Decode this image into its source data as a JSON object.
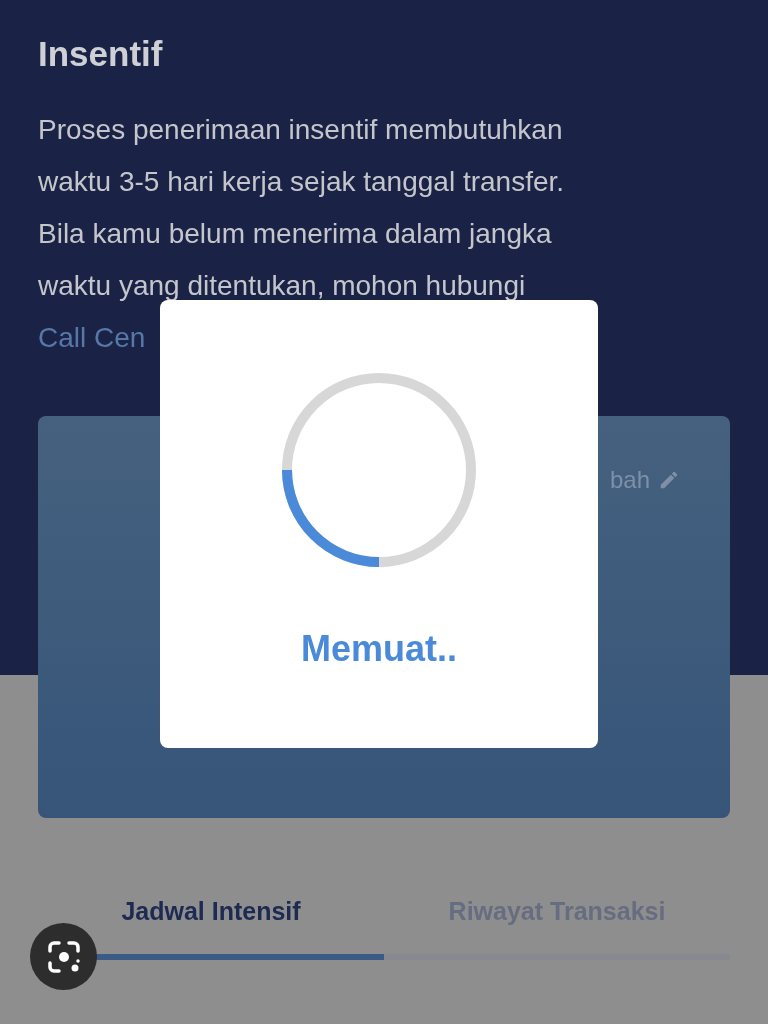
{
  "title": "Insentif",
  "info": {
    "lines": [
      "Proses penerimaan insentif membutuhkan",
      "waktu 3-5 hari kerja sejak tanggal transfer.",
      "Bila kamu belum menerima dalam jangka",
      "waktu yang ditentukan, mohon hubungi"
    ],
    "link": "Call Cen"
  },
  "card": {
    "edit_label": "bah"
  },
  "tabs": [
    {
      "label": "Jadwal Intensif",
      "selected": true
    },
    {
      "label": "Riwayat Transaksi",
      "selected": false
    }
  ],
  "loading_dialog": {
    "message": "Memuat.."
  }
}
